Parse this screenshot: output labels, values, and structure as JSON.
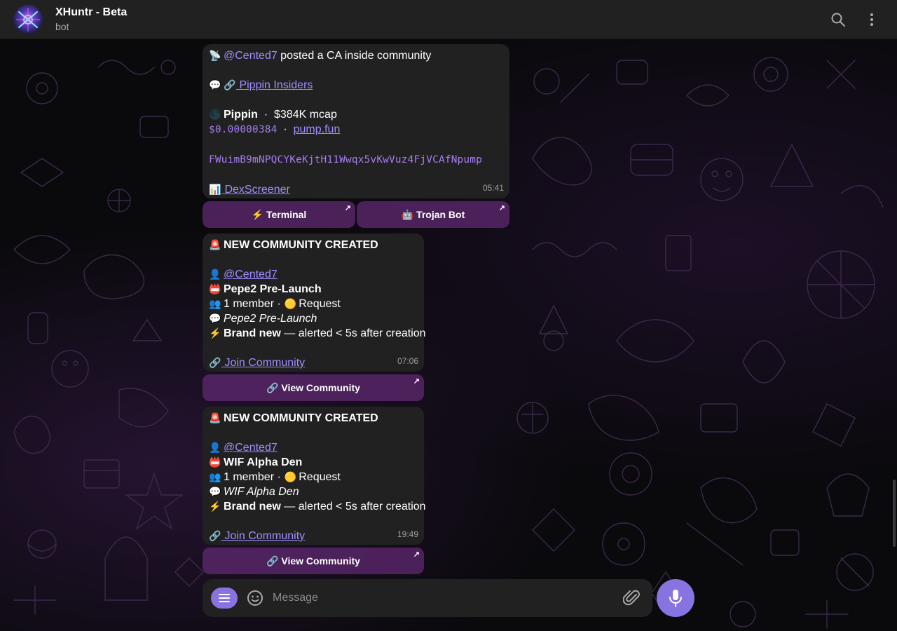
{
  "header": {
    "title": "XHuntr - Beta",
    "subtitle": "bot",
    "search_icon": "search-icon",
    "more_icon": "more-vertical-icon"
  },
  "messages": [
    {
      "user": "@Cented7",
      "action": " posted a CA inside community",
      "community_link": " Pippin Insiders",
      "token_name": "Pippin",
      "mcap": "$384K mcap",
      "price": "$0.00000384",
      "platform_link": "pump.fun",
      "contract": "FWuimB9mNPQCYKeKjtH11Wwqx5vKwVuz4FjVCAfNpump",
      "chart_link": " DexScreener",
      "time": "05:41",
      "buttons": [
        "⚡ Terminal",
        "🤖 Trojan Bot"
      ]
    },
    {
      "heading": "NEW COMMUNITY CREATED",
      "user": "@Cented7",
      "community_name": "Pepe2 Pre-Launch",
      "members": "1 member · ",
      "join_type": "Request",
      "description": "Pepe2 Pre-Launch",
      "brand_new": "Brand new",
      "alert_text": " — alerted < 5s after creation",
      "join_link": " Join Community",
      "time": "07:06",
      "button": "🔗 View Community"
    },
    {
      "heading": "NEW COMMUNITY CREATED",
      "user": "@Cented7",
      "community_name": "WIF Alpha Den",
      "members": "1 member · ",
      "join_type": "Request",
      "description": "WIF Alpha Den",
      "brand_new": "Brand new",
      "alert_text": " — alerted < 5s after creation",
      "join_link": " Join Community",
      "time": "19:49",
      "button": "🔗 View Community"
    }
  ],
  "composer": {
    "placeholder": "Message"
  },
  "colors": {
    "accent": "#8774e1",
    "link": "#9e8fff",
    "bubble": "#212121",
    "inline_button": "#5c286e"
  }
}
